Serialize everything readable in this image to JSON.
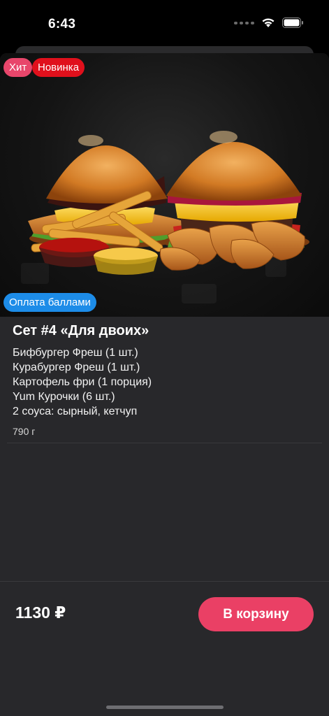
{
  "status_bar": {
    "time": "6:43"
  },
  "product": {
    "badges": {
      "hit": "Хит",
      "new": "Новинка",
      "points": "Оплата баллами"
    },
    "title": "Сет #4 «Для двоих»",
    "items": [
      "Бифбургер Фреш (1 шт.)",
      "Курабургер Фреш (1 шт.)",
      "Картофель фри (1 порция)",
      "Yum Курочки (6 шт.)",
      "2 соуса: сырный, кетчуп"
    ],
    "weight": "790 г"
  },
  "footer": {
    "price": "1130 ₽",
    "cart_button": "В корзину"
  },
  "colors": {
    "accent": "#ea4065",
    "badge_hit": "#e8466b",
    "badge_new": "#e0101c",
    "badge_points": "#1d8ce8",
    "background": "#28282b"
  }
}
